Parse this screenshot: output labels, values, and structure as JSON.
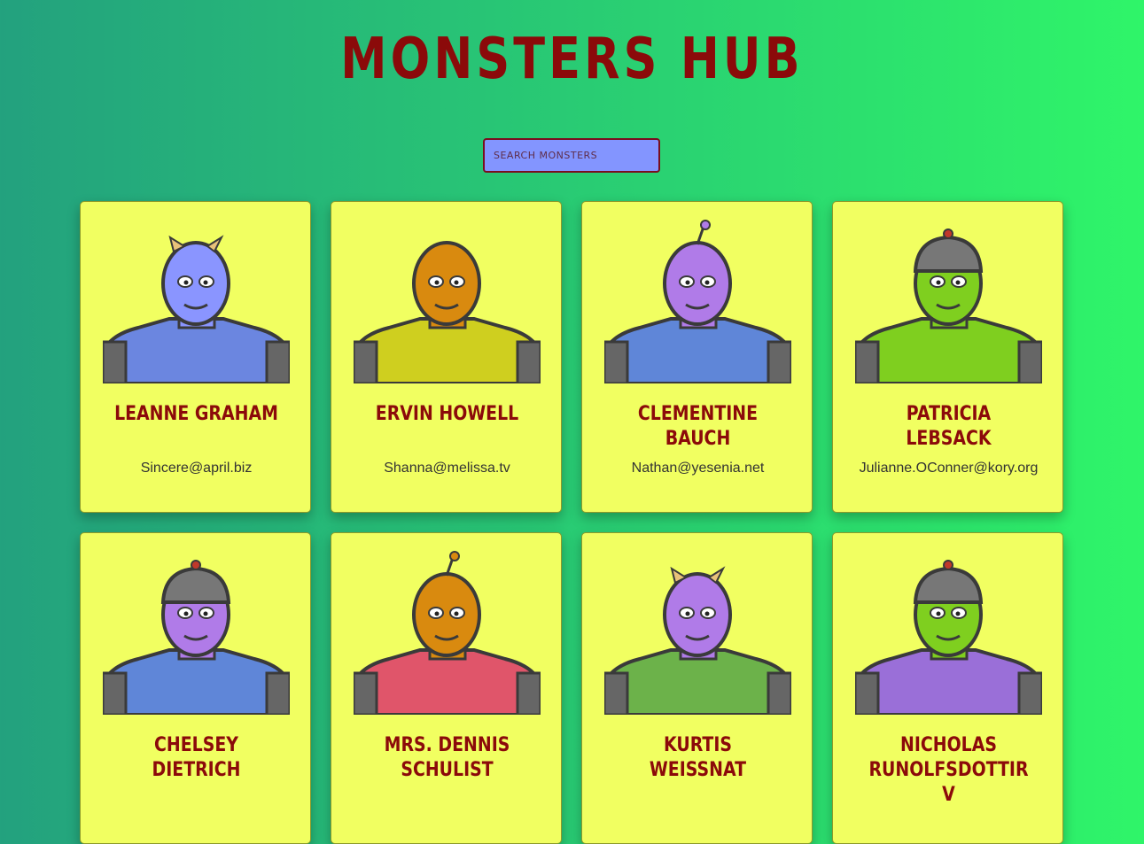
{
  "app": {
    "title": "Monsters Hub"
  },
  "search": {
    "placeholder": "Search Monsters"
  },
  "monsters": [
    {
      "name": "Leanne Graham",
      "email": "Sincere@april.biz",
      "skin": "#8a95ff",
      "body": "#6b86e0",
      "head": "horns"
    },
    {
      "name": "Ervin Howell",
      "email": "Shanna@melissa.tv",
      "skin": "#d98a0f",
      "body": "#cfcf1f",
      "head": "bald"
    },
    {
      "name": "Clementine Bauch",
      "email": "Nathan@yesenia.net",
      "skin": "#b07be8",
      "body": "#5f86d8",
      "head": "antenna"
    },
    {
      "name": "Patricia Lebsack",
      "email": "Julianne.OConner@kory.org",
      "skin": "#7fcf1f",
      "body": "#7fcf1f",
      "head": "helmet"
    },
    {
      "name": "Chelsey Dietrich",
      "email": "",
      "skin": "#b07be8",
      "body": "#5f86d8",
      "head": "helmet"
    },
    {
      "name": "Mrs. Dennis Schulist",
      "email": "",
      "skin": "#d98a0f",
      "body": "#e0556a",
      "head": "antenna"
    },
    {
      "name": "Kurtis Weissnat",
      "email": "",
      "skin": "#b07be8",
      "body": "#6cb24a",
      "head": "horns"
    },
    {
      "name": "Nicholas Runolfsdottir V",
      "email": "",
      "skin": "#7fcf1f",
      "body": "#9a6fd8",
      "head": "helmet"
    }
  ]
}
